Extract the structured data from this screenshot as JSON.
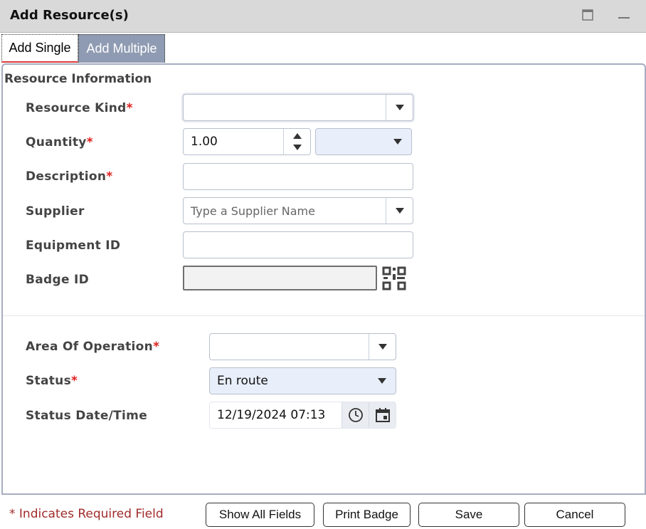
{
  "window": {
    "title": "Add Resource(s)",
    "maximize_icon": "maximize-icon",
    "minimize_icon": "minimize-icon"
  },
  "tabs": [
    {
      "label": "Add Single",
      "active": true
    },
    {
      "label": "Add Multiple",
      "active": false
    }
  ],
  "section": {
    "title": "Resource Information"
  },
  "fields": {
    "resource_kind": {
      "label": "Resource Kind",
      "required_mark": "*",
      "value": ""
    },
    "quantity": {
      "label": "Quantity",
      "required_mark": "*",
      "value": "1.00",
      "unit_value": ""
    },
    "description": {
      "label": "Description",
      "required_mark": "*",
      "value": ""
    },
    "supplier": {
      "label": "Supplier",
      "placeholder": "Type a Supplier Name",
      "value": ""
    },
    "equipment_id": {
      "label": "Equipment ID",
      "value": ""
    },
    "badge_id": {
      "label": "Badge ID",
      "value": "",
      "scan_icon": "qr-code-icon"
    },
    "area_of_operation": {
      "label": "Area Of Operation",
      "required_mark": "*",
      "value": ""
    },
    "status": {
      "label": "Status",
      "required_mark": "*",
      "value": "En route"
    },
    "status_datetime": {
      "label": "Status Date/Time",
      "value": "12/19/2024 07:13",
      "time_icon": "clock-icon",
      "date_icon": "calendar-icon"
    }
  },
  "footer": {
    "required_note": "* Indicates Required Field",
    "buttons": {
      "show_all": "Show All Fields",
      "print_badge": "Print Badge",
      "save": "Save",
      "cancel": "Cancel"
    }
  },
  "colors": {
    "required": "#e01c1c",
    "tab_inactive_bg": "#8f9bb2",
    "panel_border": "#a6adc1",
    "active_tab_underline": "#d83b3b"
  }
}
